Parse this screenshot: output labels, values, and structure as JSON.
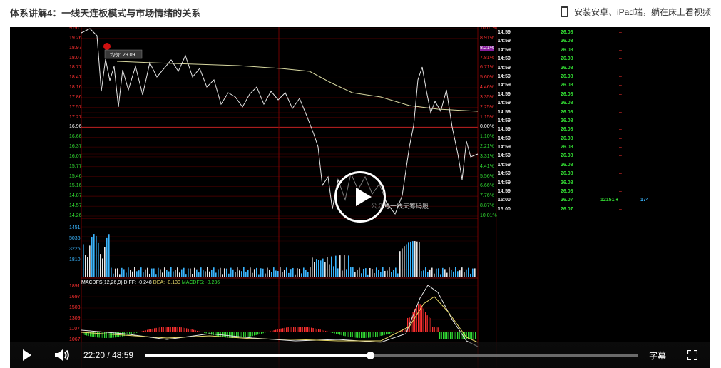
{
  "page": {
    "title": "体系讲解4：一线天连板模式与市场情绪的关系",
    "promo_text": "安装安卓、iPad端，躺在床上看视频"
  },
  "chart": {
    "left_axis": [
      "9.56",
      "19.26",
      "18.97",
      "18.07",
      "18.77",
      "18.47",
      "18.16",
      "17.86",
      "17.57",
      "17.27",
      "16.96",
      "16.66",
      "16.37",
      "16.07",
      "15.77",
      "15.46",
      "15.16",
      "14.87",
      "14.57",
      "14.26"
    ],
    "right_axis": [
      "10.01%",
      "8.91%",
      "8.21%",
      "7.81%",
      "6.71%",
      "5.60%",
      "4.46%",
      "3.35%",
      "2.25%",
      "1.15%",
      "0.00%",
      "1.10%",
      "2.21%",
      "3.31%",
      "4.41%",
      "5.56%",
      "6.66%",
      "7.76%",
      "8.87%",
      "10.01%"
    ],
    "avg_tooltip": "均价: 29.09",
    "volume_axis": [
      "1451",
      "5036",
      "3226",
      "1810"
    ],
    "macd_axis": [
      "1891",
      "1697",
      "1503",
      "1309",
      "1107",
      "1067"
    ],
    "macd_label": {
      "macd": "MACDFS(12,26,9)",
      "diff": "DIFF: -0.248",
      "dea": "DEA: -0.130",
      "macdfs": "MACDFS: -0.236"
    },
    "watermark": "公众号一线天筹码股"
  },
  "ticker_tape": [
    {
      "time": "14:59",
      "price": "26.08",
      "vol": "",
      "num": "",
      "dash": "–"
    },
    {
      "time": "14:59",
      "price": "26.08",
      "vol": "",
      "num": "",
      "dash": "–"
    },
    {
      "time": "14:59",
      "price": "26.08",
      "vol": "",
      "num": "",
      "dash": "–"
    },
    {
      "time": "14:59",
      "price": "26.08",
      "vol": "",
      "num": "",
      "dash": "–"
    },
    {
      "time": "14:59",
      "price": "26.08",
      "vol": "",
      "num": "",
      "dash": "–"
    },
    {
      "time": "14:59",
      "price": "26.08",
      "vol": "",
      "num": "",
      "dash": "–"
    },
    {
      "time": "14:59",
      "price": "26.08",
      "vol": "",
      "num": "",
      "dash": "–"
    },
    {
      "time": "14:59",
      "price": "26.08",
      "vol": "",
      "num": "",
      "dash": "–"
    },
    {
      "time": "14:59",
      "price": "26.08",
      "vol": "",
      "num": "",
      "dash": "–"
    },
    {
      "time": "14:59",
      "price": "26.08",
      "vol": "",
      "num": "",
      "dash": "–"
    },
    {
      "time": "14:59",
      "price": "26.08",
      "vol": "",
      "num": "",
      "dash": "–"
    },
    {
      "time": "14:59",
      "price": "26.08",
      "vol": "",
      "num": "",
      "dash": "–"
    },
    {
      "time": "14:59",
      "price": "26.08",
      "vol": "",
      "num": "",
      "dash": "–"
    },
    {
      "time": "14:59",
      "price": "26.08",
      "vol": "",
      "num": "",
      "dash": "–"
    },
    {
      "time": "14:59",
      "price": "26.08",
      "vol": "",
      "num": "",
      "dash": "–"
    },
    {
      "time": "14:59",
      "price": "26.08",
      "vol": "",
      "num": "",
      "dash": "–"
    },
    {
      "time": "14:59",
      "price": "26.08",
      "vol": "",
      "num": "",
      "dash": "–"
    },
    {
      "time": "14:59",
      "price": "26.08",
      "vol": "",
      "num": "",
      "dash": "–"
    },
    {
      "time": "14:59",
      "price": "26.08",
      "vol": "",
      "num": "",
      "dash": "–"
    },
    {
      "time": "15:00",
      "price": "26.07",
      "vol": "12151 ♦",
      "num": "174",
      "dash": ""
    },
    {
      "time": "15:00",
      "price": "26.07",
      "vol": "",
      "num": "",
      "dash": "–"
    }
  ],
  "player": {
    "current_time": "22:20",
    "separator": "/",
    "duration": "48:59",
    "progress_fraction": 0.456,
    "subtitle_label": "字幕",
    "icons": {
      "play": "play-icon",
      "volume": "volume-icon",
      "fullscreen": "fullscreen-icon",
      "big_play": "play-icon"
    }
  },
  "colors": {
    "grid_red": "#8b0000",
    "price_line": "#dddddd",
    "avg_line": "#d8d8a0",
    "up": "#ff3030",
    "down": "#33dd33",
    "volume": "#3ab6ff"
  }
}
